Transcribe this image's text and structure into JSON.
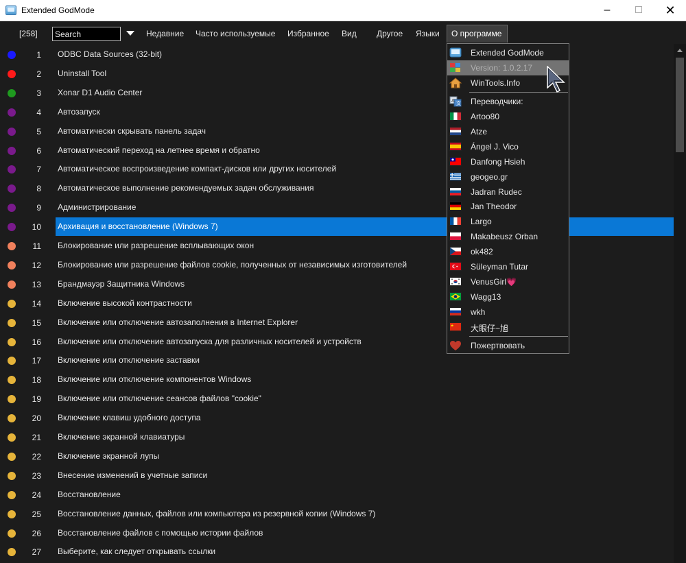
{
  "window": {
    "title": "Extended GodMode"
  },
  "toolbar": {
    "count": "[258]",
    "search_placeholder": "Search",
    "menu": [
      {
        "label": "Недавние"
      },
      {
        "label": "Часто используемые"
      },
      {
        "label": "Избранное"
      },
      {
        "label": "Вид"
      },
      {
        "label": "Другое"
      },
      {
        "label": "Языки"
      },
      {
        "label": "О программе"
      }
    ]
  },
  "list": {
    "items": [
      {
        "num": "1",
        "label": "ODBC Data Sources (32-bit)",
        "color": "#1a1aff"
      },
      {
        "num": "2",
        "label": "Uninstall Tool",
        "color": "#ff1a1a"
      },
      {
        "num": "3",
        "label": "Xonar D1 Audio Center",
        "color": "#1f9a1f"
      },
      {
        "num": "4",
        "label": "Автозапуск",
        "color": "#7a1a8c"
      },
      {
        "num": "5",
        "label": "Автоматически скрывать панель задач",
        "color": "#7a1a8c"
      },
      {
        "num": "6",
        "label": "Автоматический переход на летнее время и обратно",
        "color": "#7a1a8c"
      },
      {
        "num": "7",
        "label": "Автоматическое воспроизведение компакт-дисков или других носителей",
        "color": "#7a1a8c"
      },
      {
        "num": "8",
        "label": "Автоматическое выполнение рекомендуемых задач обслуживания",
        "color": "#7a1a8c"
      },
      {
        "num": "9",
        "label": "Администрирование",
        "color": "#7a1a8c"
      },
      {
        "num": "10",
        "label": "Архивация и восстановление (Windows 7)",
        "color": "#7a1a8c"
      },
      {
        "num": "11",
        "label": "Блокирование или разрешение всплывающих окон",
        "color": "#f0805c"
      },
      {
        "num": "12",
        "label": "Блокирование или разрешение файлов cookie, полученных от независимых изготовителей",
        "color": "#f0805c"
      },
      {
        "num": "13",
        "label": "Брандмауэр Защитника Windows",
        "color": "#f0805c"
      },
      {
        "num": "14",
        "label": "Включение высокой контрастности",
        "color": "#e6b43a"
      },
      {
        "num": "15",
        "label": "Включение или отключение автозаполнения в Internet Explorer",
        "color": "#e6b43a"
      },
      {
        "num": "16",
        "label": "Включение или отключение автозапуска для различных носителей и устройств",
        "color": "#e6b43a"
      },
      {
        "num": "17",
        "label": "Включение или отключение заставки",
        "color": "#e6b43a"
      },
      {
        "num": "18",
        "label": "Включение или отключение компонентов Windows",
        "color": "#e6b43a"
      },
      {
        "num": "19",
        "label": "Включение или отключение сеансов файлов \"cookie\"",
        "color": "#e6b43a"
      },
      {
        "num": "20",
        "label": "Включение клавиш удобного доступа",
        "color": "#e6b43a"
      },
      {
        "num": "21",
        "label": "Включение экранной клавиатуры",
        "color": "#e6b43a"
      },
      {
        "num": "22",
        "label": "Включение экранной лупы",
        "color": "#e6b43a"
      },
      {
        "num": "23",
        "label": "Внесение изменений в учетные записи",
        "color": "#e6b43a"
      },
      {
        "num": "24",
        "label": "Восстановление",
        "color": "#e6b43a"
      },
      {
        "num": "25",
        "label": "Восстановление данных, файлов или компьютера из резервной копии (Windows 7)",
        "color": "#e6b43a"
      },
      {
        "num": "26",
        "label": "Восстановление файлов с помощью истории файлов",
        "color": "#e6b43a"
      },
      {
        "num": "27",
        "label": "Выберите, как следует открывать ссылки",
        "color": "#e6b43a"
      }
    ]
  },
  "about_menu": {
    "app_name": "Extended GodMode",
    "version": "Version: 1.0.2.17",
    "website": "WinTools.Info",
    "translators_heading": "Переводчики:",
    "translators": [
      {
        "name": "Artoo80",
        "flag": "italy"
      },
      {
        "name": "Atze",
        "flag": "netherlands"
      },
      {
        "name": "Ángel J. Vico",
        "flag": "spain"
      },
      {
        "name": "Danfong Hsieh",
        "flag": "taiwan"
      },
      {
        "name": "geogeo.gr",
        "flag": "greece"
      },
      {
        "name": "Jadran Rudec",
        "flag": "slovenia"
      },
      {
        "name": "Jan Theodor",
        "flag": "germany"
      },
      {
        "name": "Largo",
        "flag": "france"
      },
      {
        "name": "Makabeusz Orban",
        "flag": "poland"
      },
      {
        "name": "ok482",
        "flag": "czech"
      },
      {
        "name": "Süleyman Tutar",
        "flag": "turkey"
      },
      {
        "name": "VenusGirl💗",
        "flag": "korea"
      },
      {
        "name": "Wagg13",
        "flag": "brazil"
      },
      {
        "name": "wkh",
        "flag": "russia"
      },
      {
        "name": "大眼仔~旭",
        "flag": "china"
      }
    ],
    "donate": "Пожертвовать"
  }
}
